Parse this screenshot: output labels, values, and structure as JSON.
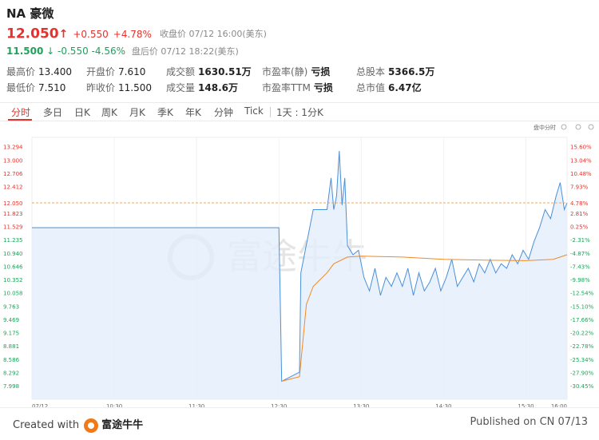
{
  "header": {
    "title": "NA 豪微",
    "price": "12.050",
    "change": "+0.550",
    "change_pct": "+4.78%",
    "close_label": "收盘价 07/12 16:00(美东)",
    "after_price": "11.500",
    "after_change": "-0.550",
    "after_change_pct": "-4.56%",
    "after_label": "盘后价 07/12 18:22(美东)"
  },
  "stats": [
    [
      {
        "label": "最高价",
        "value": "13.400",
        "color": "red"
      },
      {
        "label": "开盘价",
        "value": "7.610",
        "color": "green"
      },
      {
        "label": "成交额",
        "value": "1630.51万",
        "color": "normal"
      },
      {
        "label": "市盈率(静)",
        "value": "亏损",
        "color": "normal"
      },
      {
        "label": "总股本",
        "value": "5366.5万",
        "color": "normal"
      }
    ],
    [
      {
        "label": "最低价",
        "value": "7.510",
        "color": "green"
      },
      {
        "label": "昨收价",
        "value": "11.500",
        "color": "normal"
      },
      {
        "label": "成交量",
        "value": "148.6万",
        "color": "normal"
      },
      {
        "label": "市盈率TTM",
        "value": "亏损",
        "color": "normal"
      },
      {
        "label": "总市值",
        "value": "6.47亿",
        "color": "normal"
      }
    ]
  ],
  "tabs": [
    "分时",
    "多日",
    "日K",
    "周K",
    "月K",
    "季K",
    "年K",
    "分钟",
    "Tick"
  ],
  "range_label": "1天 : 1分K",
  "chart_menu_label": "盘中分时",
  "watermark": "富途牛牛",
  "footer": {
    "created_with": "Created with",
    "brand": "富途牛牛",
    "published": "Published on CN 07/13"
  },
  "colors": {
    "up": "#e7312c",
    "down": "#1ea25a",
    "price_line": "#4a90d9",
    "avg_line": "#f08a24",
    "area_fill": "#e3eefb"
  },
  "chart_data": {
    "type": "line",
    "title": "",
    "prev_close": 11.5,
    "current": 12.05,
    "ylim": [
      7.7,
      13.5
    ],
    "y_ticks_left": [
      "13.294",
      "13.000",
      "12.706",
      "12.412",
      "12.050",
      "11.823",
      "11.529",
      "11.235",
      "10.940",
      "10.646",
      "10.352",
      "10.058",
      "9.763",
      "9.469",
      "9.175",
      "8.881",
      "8.586",
      "8.292",
      "7.998"
    ],
    "y_ticks_right": [
      "15.60%",
      "13.04%",
      "10.48%",
      "7.93%",
      "4.78%",
      "2.81%",
      "0.25%",
      "-2.31%",
      "-4.87%",
      "-7.43%",
      "-9.98%",
      "-12.54%",
      "-15.10%",
      "-17.66%",
      "-20.22%",
      "-22.78%",
      "-25.34%",
      "-27.90%",
      "-30.45%"
    ],
    "x_ticks": [
      "07/12",
      "10:30",
      "11:30",
      "12:30",
      "13:30",
      "14:30",
      "15:30",
      "16:00"
    ],
    "x_label_note": "",
    "series": [
      {
        "name": "price",
        "points": [
          [
            "09:30",
            11.5
          ],
          [
            "12:30",
            11.5
          ],
          [
            "12:31",
            9.9
          ],
          [
            "12:32",
            8.1
          ],
          [
            "12:45",
            8.3
          ],
          [
            "12:46",
            10.5
          ],
          [
            "12:55",
            11.9
          ],
          [
            "13:05",
            11.9
          ],
          [
            "13:08",
            12.6
          ],
          [
            "13:10",
            11.9
          ],
          [
            "13:12",
            12.2
          ],
          [
            "13:14",
            13.2
          ],
          [
            "13:16",
            12.0
          ],
          [
            "13:18",
            12.6
          ],
          [
            "13:20",
            11.1
          ],
          [
            "13:24",
            10.9
          ],
          [
            "13:28",
            11.0
          ],
          [
            "13:32",
            10.4
          ],
          [
            "13:36",
            10.1
          ],
          [
            "13:40",
            10.6
          ],
          [
            "13:44",
            10.0
          ],
          [
            "13:48",
            10.4
          ],
          [
            "13:52",
            10.2
          ],
          [
            "13:56",
            10.5
          ],
          [
            "14:00",
            10.2
          ],
          [
            "14:04",
            10.6
          ],
          [
            "14:08",
            10.0
          ],
          [
            "14:12",
            10.5
          ],
          [
            "14:16",
            10.1
          ],
          [
            "14:20",
            10.3
          ],
          [
            "14:24",
            10.6
          ],
          [
            "14:28",
            10.1
          ],
          [
            "14:32",
            10.4
          ],
          [
            "14:36",
            10.8
          ],
          [
            "14:40",
            10.2
          ],
          [
            "14:44",
            10.4
          ],
          [
            "14:48",
            10.6
          ],
          [
            "14:52",
            10.3
          ],
          [
            "14:56",
            10.7
          ],
          [
            "15:00",
            10.5
          ],
          [
            "15:04",
            10.8
          ],
          [
            "15:08",
            10.5
          ],
          [
            "15:12",
            10.7
          ],
          [
            "15:16",
            10.6
          ],
          [
            "15:20",
            10.9
          ],
          [
            "15:24",
            10.7
          ],
          [
            "15:28",
            11.0
          ],
          [
            "15:32",
            10.8
          ],
          [
            "15:36",
            11.2
          ],
          [
            "15:40",
            11.5
          ],
          [
            "15:44",
            11.9
          ],
          [
            "15:48",
            11.7
          ],
          [
            "15:52",
            12.2
          ],
          [
            "15:55",
            12.5
          ],
          [
            "15:58",
            11.9
          ],
          [
            "16:00",
            12.05
          ]
        ]
      },
      {
        "name": "average",
        "points": [
          [
            "12:32",
            8.1
          ],
          [
            "12:45",
            8.2
          ],
          [
            "12:50",
            9.8
          ],
          [
            "12:55",
            10.2
          ],
          [
            "13:05",
            10.5
          ],
          [
            "13:10",
            10.7
          ],
          [
            "13:20",
            10.85
          ],
          [
            "13:30",
            10.87
          ],
          [
            "14:00",
            10.85
          ],
          [
            "14:30",
            10.8
          ],
          [
            "15:00",
            10.78
          ],
          [
            "15:30",
            10.77
          ],
          [
            "15:50",
            10.8
          ],
          [
            "16:00",
            10.9
          ]
        ]
      }
    ]
  }
}
